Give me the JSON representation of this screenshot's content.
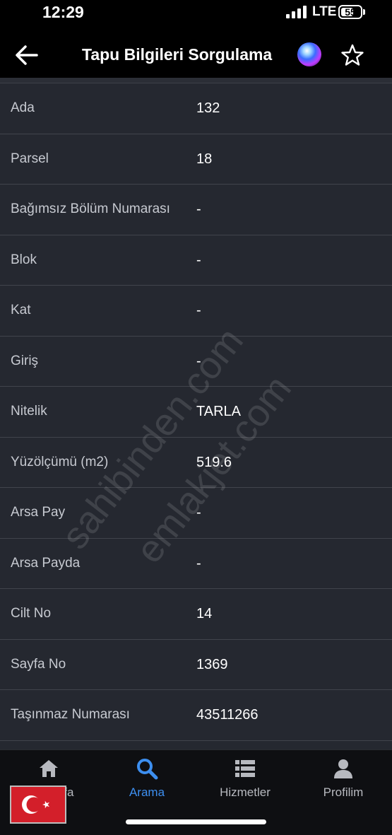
{
  "status_bar": {
    "time": "12:29",
    "network": "LTE",
    "battery": "55"
  },
  "header": {
    "title": "Tapu Bilgileri Sorgulama"
  },
  "rows": [
    {
      "label": "Ada",
      "value": "132"
    },
    {
      "label": "Parsel",
      "value": "18"
    },
    {
      "label": "Bağımsız Bölüm Numarası",
      "value": "-"
    },
    {
      "label": "Blok",
      "value": "-"
    },
    {
      "label": "Kat",
      "value": "-"
    },
    {
      "label": "Giriş",
      "value": "-"
    },
    {
      "label": "Nitelik",
      "value": "TARLA"
    },
    {
      "label": "Yüzölçümü (m2)",
      "value": "519.6"
    },
    {
      "label": "Arsa Pay",
      "value": "-"
    },
    {
      "label": "Arsa Payda",
      "value": "-"
    },
    {
      "label": "Cilt No",
      "value": "14"
    },
    {
      "label": "Sayfa No",
      "value": "1369"
    },
    {
      "label": "Taşınmaz Numarası",
      "value": "43511266"
    }
  ],
  "watermarks": [
    "sahibinden.com",
    "emlakjet.com"
  ],
  "tabs": [
    {
      "label": "Anasayfa",
      "icon": "home-icon"
    },
    {
      "label": "Arama",
      "icon": "search-icon",
      "active": true
    },
    {
      "label": "Hizmetler",
      "icon": "list-icon"
    },
    {
      "label": "Profilim",
      "icon": "person-icon"
    }
  ],
  "colors": {
    "accent": "#3d8ff0",
    "flag": "#d31f2a"
  }
}
